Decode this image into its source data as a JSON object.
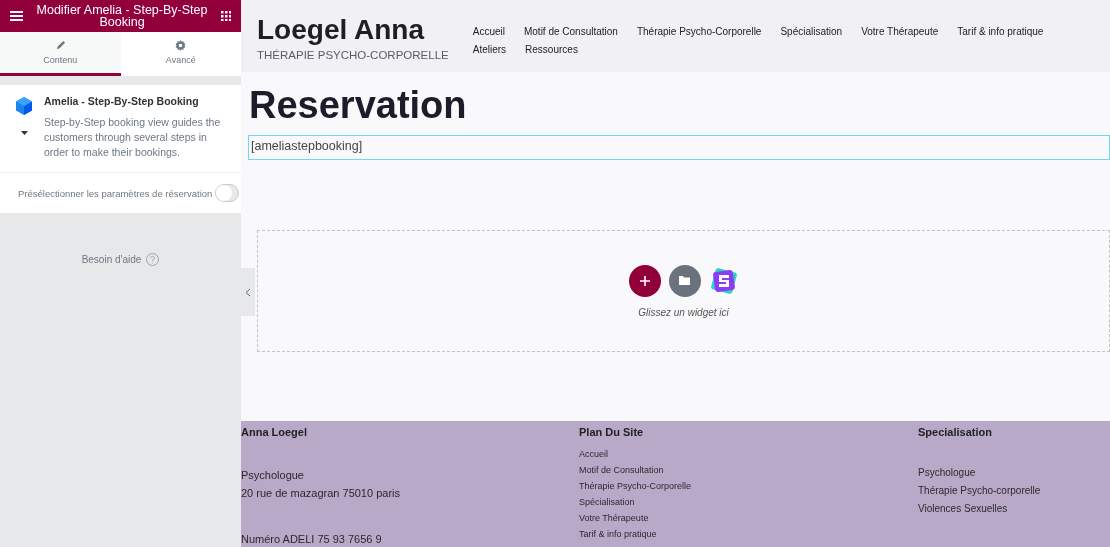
{
  "editor": {
    "title": "Modifier Amelia - Step-By-Step Booking",
    "tabs": [
      {
        "label": "Contenu",
        "kind": "pencil",
        "selected": true
      },
      {
        "label": "Avancé",
        "kind": "gear",
        "selected": false
      }
    ],
    "widget": {
      "name": "Amelia - Step-By-Step Booking",
      "description": "Step-by-Step booking view guides the customers through several steps in order to make their bookings."
    },
    "toggle": {
      "label": "Présélectionner les paramètres de réservation",
      "on": false
    },
    "help": "Besoin d'aide"
  },
  "site": {
    "title": "Loegel Anna",
    "tagline": "THÉRAPIE PSYCHO-CORPORELLE",
    "nav": [
      "Accueil",
      "Motif de Consultation",
      "Thérapie Psycho-Corporelle",
      "Spécialisation",
      "Votre Thérapeute",
      "Tarif & info pratique",
      "Ateliers",
      "Ressources"
    ]
  },
  "page": {
    "heading": "Reservation",
    "shortcode": "[ameliastepbooking]",
    "drop_hint": "Glissez un widget ici"
  },
  "footer": {
    "columns": [
      {
        "heading": "Anna Loegel",
        "kind": "text",
        "items": [
          "Psychologue",
          "20 rue de mazagran 75010 paris",
          "Numéro ADELI 75 93 7656 9"
        ]
      },
      {
        "heading": "Plan Du Site",
        "kind": "links",
        "items": [
          "Accueil",
          "Motif de Consultation",
          "Thérapie Psycho-Corporelle",
          "Spécialisation",
          "Votre Thérapeute",
          "Tarif & info pratique"
        ]
      },
      {
        "heading": "Specialisation",
        "kind": "links",
        "items": [
          "Psychologue",
          "Thérapie Psycho-corporelle",
          "Violences Sexuelles"
        ]
      }
    ]
  }
}
